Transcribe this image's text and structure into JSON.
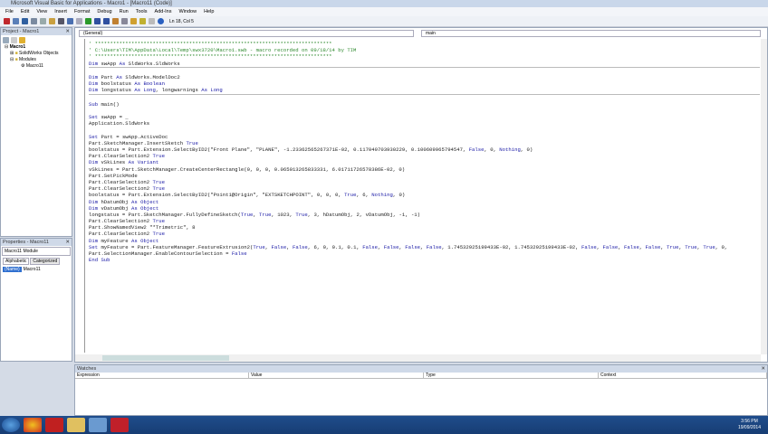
{
  "window": {
    "title": "Microsoft Visual Basic for Applications - Macro1 - [Macro11 (Code)]"
  },
  "menu": [
    "File",
    "Edit",
    "View",
    "Insert",
    "Format",
    "Debug",
    "Run",
    "Tools",
    "Add-Ins",
    "Window",
    "Help"
  ],
  "toolbar": {
    "position": "Ln 18, Col 5"
  },
  "project": {
    "title": "Project - Macro1",
    "root": "Macro1",
    "items": [
      "SolidWorks Objects",
      "Modules",
      "Macro11"
    ]
  },
  "properties": {
    "title": "Properties - Macro11",
    "object": "Macro11 Module",
    "tabs": [
      "Alphabetic",
      "Categorized"
    ],
    "name_key": "(Name)",
    "name_value": "Macro11"
  },
  "code": {
    "object_combo": "(General)",
    "proc_combo": "main",
    "keywords": [
      "Dim",
      "As",
      "Set",
      "Sub",
      "End",
      "True",
      "False",
      "Nothing",
      "Boolean",
      "Long",
      "Variant",
      "Object"
    ],
    "lines": [
      "' ******************************************************************************",
      "' C:\\Users\\TIM\\AppData\\Local\\Temp\\swx3720\\Macro1.swb - macro recorded on 09/18/14 by TIM",
      "' ******************************************************************************",
      "Dim swApp As SldWorks.SldWorks",
      "",
      "Dim Part As SldWorks.ModelDoc2",
      "Dim boolstatus As Boolean",
      "Dim longstatus As Long, longwarnings As Long",
      "",
      "Sub main()",
      "",
      "Set swApp = _",
      "Application.SldWorks",
      "",
      "Set Part = swApp.ActiveDoc",
      "Part.SketchManager.InsertSketch True",
      "boolstatus = Part.Extension.SelectByID2(\"Front Plane\", \"PLANE\", -1.23362565267371E-02, 0.117040703930229, 0.100609965794547, False, 0, Nothing, 0)",
      "Part.ClearSelection2 True",
      "Dim vSkLines As Variant",
      "vSkLines = Part.SketchManager.CreateCenterRectangle(0, 0, 0, 0.065013265833331, 6.01711726578386E-02, 0)",
      "Part.SetPickMode",
      "Part.ClearSelection2 True",
      "Part.ClearSelection2 True",
      "boolstatus = Part.Extension.SelectByID2(\"Point1@Origin\", \"EXTSKETCHPOINT\", 0, 0, 0, True, 6, Nothing, 0)",
      "Dim hDatumObj As Object",
      "Dim vDatumObj As Object",
      "longstatus = Part.SketchManager.FullyDefineSketch(True, True, 1023, True, 3, hDatumObj, 2, vDatumObj, -1, -1)",
      "Part.ClearSelection2 True",
      "Part.ShowNamedView2 \"*Trimetric\", 8",
      "Part.ClearSelection2 True",
      "Dim myFeature As Object",
      "Set myFeature = Part.FeatureManager.FeatureExtrusion2(True, False, False, 6, 0, 0.1, 0.1, False, False, False, False, 1.74532925199433E-02, 1.74532925199433E-02, False, False, False, False, True, True, True, 0,",
      "Part.SelectionManager.EnableContourSelection = False",
      "End Sub"
    ]
  },
  "watches": {
    "title": "Watches",
    "columns": [
      "Expression",
      "Value",
      "Type",
      "Context"
    ]
  },
  "taskbar": {
    "time": "3:56 PM",
    "date": "19/09/2014"
  }
}
